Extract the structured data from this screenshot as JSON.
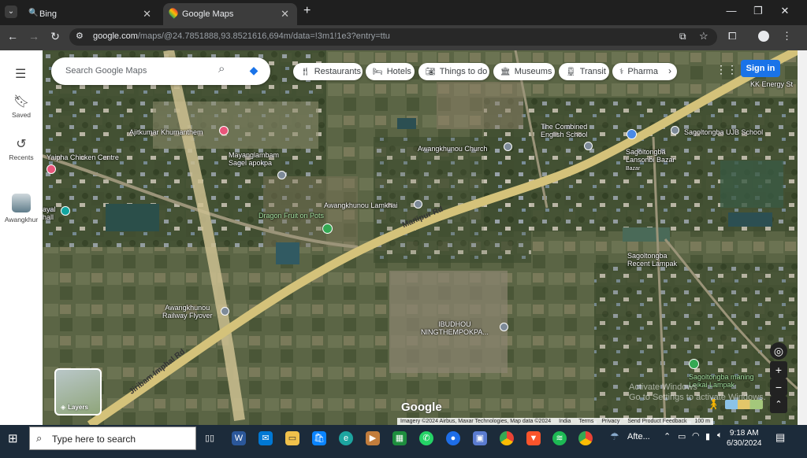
{
  "browser": {
    "tabs": [
      {
        "label": "Bing",
        "active": false
      },
      {
        "label": "Google Maps",
        "active": true
      }
    ],
    "new_tab": "+",
    "url_host": "google.com",
    "url_path": "/maps/@24.7851888,93.8521616,694m/data=!3m1!1e3?entry=ttu"
  },
  "rail": {
    "items": [
      {
        "label": "Saved",
        "icon": "bookmark-icon"
      },
      {
        "label": "Recents",
        "icon": "history-icon"
      },
      {
        "label": "Awangkhur",
        "icon": "recent-place-thumbnail"
      }
    ]
  },
  "search": {
    "placeholder": "Search Google Maps"
  },
  "chips": [
    {
      "label": "Restaurants",
      "icon": "fork-knife-icon"
    },
    {
      "label": "Hotels",
      "icon": "bed-icon"
    },
    {
      "label": "Things to do",
      "icon": "camera-icon"
    },
    {
      "label": "Museums",
      "icon": "museum-icon"
    },
    {
      "label": "Transit",
      "icon": "train-icon"
    },
    {
      "label": "Pharma",
      "icon": "pharmacy-icon"
    }
  ],
  "signin_label": "Sign in",
  "map_labels": {
    "kk_energy": "KK Energy St",
    "ajitkumar": "Ajitkumar Khumanthem",
    "yaipha": "Yaipha Chicken Centre",
    "mayang": "Mayanglambam\nSagel apokpa",
    "awang_church": "Awangkhunou Church",
    "combined_school": "The Combined\nEnglish School",
    "sagol_school": "Sagoltongba UJB School",
    "sagol_bazar": "Sagoltongba\nLansonbi Bazar",
    "bazar": "Bazar",
    "lamkhai": "Awangkhunou Lamkhai",
    "dragon_fruit": "Dragon Fruit on Pots",
    "manipur_rd": "Manipur Rd",
    "recent_lampak": "Sagoltongba\nRecent Lampak",
    "railway_flyover": "Awangkhunou\nRailway Flyover",
    "ibudhou": "IBUDHOU\nNINGTHEMPOKPA...",
    "jiribam_rd": "Jiribam Imphal Rd",
    "maning": "Sagoltongba maning\nLeikai Lampak",
    "hall": "ayal\nhall"
  },
  "layers_label": "Layers",
  "google_logo": "Google",
  "attribution": [
    "Imagery ©2024 Airbus, Maxar Technologies, Map data ©2024",
    "India",
    "Terms",
    "Privacy",
    "Send Product Feedback",
    "100 m"
  ],
  "activate_windows": "Activate Windows\nGo to Settings to activate Windows.",
  "taskbar": {
    "search_placeholder": "Type here to search",
    "weather": "Afte...",
    "time": "9:18 AM",
    "date": "6/30/2024"
  },
  "colors": {
    "accent": "#1a73e8",
    "road": "#d4c27a",
    "taskbar": "#1c2b3a"
  }
}
